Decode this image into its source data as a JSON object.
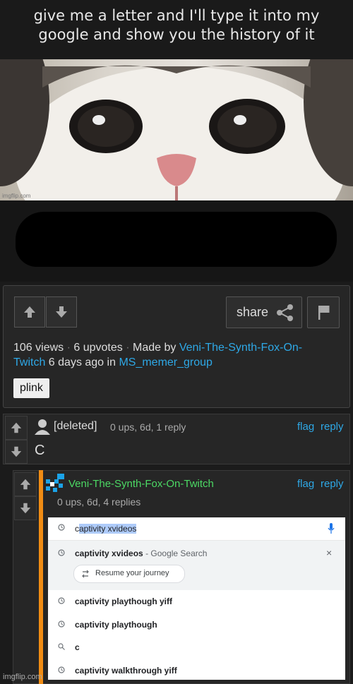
{
  "caption": {
    "line1": "give me a letter and I'll type it into my",
    "line2": "google and show you the history of it"
  },
  "image_watermark": "imgflip.com",
  "post": {
    "share_label": "share",
    "views": "106 views",
    "upvotes": "6 upvotes",
    "made_by_prefix": "Made by",
    "author_part1": "Veni-The-Synth-Fox-On-",
    "author_part2": "Twitch",
    "time_text": "6 days ago in",
    "group": "MS_memer_group",
    "tag": "plink"
  },
  "comment1": {
    "author": "[deleted]",
    "meta": "0 ups, 6d, 1 reply",
    "flag": "flag",
    "reply": "reply",
    "text": "C"
  },
  "comment2": {
    "author": "Veni-The-Synth-Fox-On-Twitch",
    "meta": "0 ups, 6d, 4 replies",
    "flag": "flag",
    "reply": "reply",
    "author_color": "#4cd964"
  },
  "google": {
    "typed_prefix": "c",
    "typed_highlight": "aptivity xvideos",
    "suggestion1_main": "captivity xvideos",
    "suggestion1_sub": "- Google Search",
    "resume_label": "Resume your journey",
    "history": [
      "captivity playthough yiff",
      "captivity playthough",
      "c",
      "captivity walkthrough yiff"
    ]
  },
  "footer_watermark": "imgflip.com",
  "colors": {
    "accent_link": "#2ea8e6",
    "thread_bar": "#f08c14",
    "mic": "#1a73e8"
  }
}
